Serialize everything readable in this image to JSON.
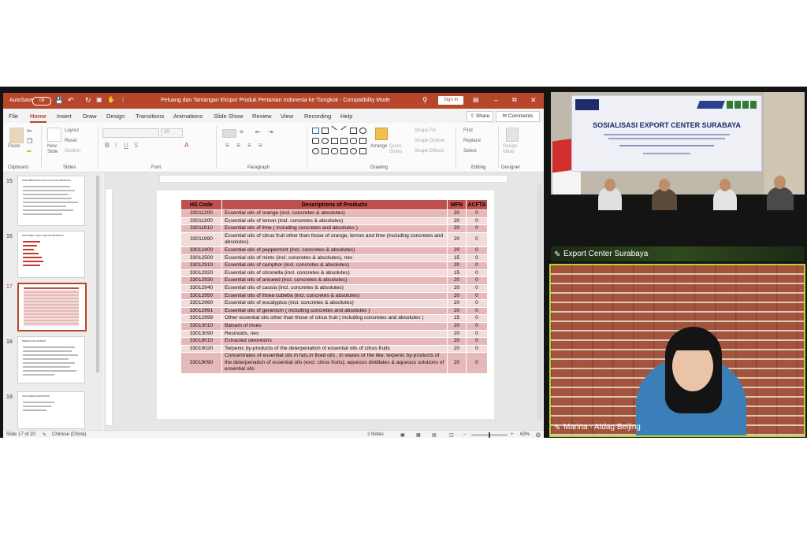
{
  "window": {
    "autosave_label": "AutoSave",
    "autosave_state": "Off",
    "title": "Peluang dan Tantangan Ekspor Produk Pertanian Indonesia ke Tiongkok  -  Compatibility Mode",
    "signin_label": "Sign in"
  },
  "menu": {
    "tabs": [
      "File",
      "Home",
      "Insert",
      "Draw",
      "Design",
      "Transitions",
      "Animations",
      "Slide Show",
      "Review",
      "View",
      "Recording",
      "Help"
    ],
    "active_tab": "Home",
    "share_label": "Share",
    "comments_label": "Comments"
  },
  "ribbon": {
    "paste": "Paste",
    "new_slide": "New Slide",
    "layout": "Layout",
    "reset": "Reset",
    "section": "Section",
    "font_size": "20",
    "arrange": "Arrange",
    "quick_styles": "Quick Styles",
    "shape_fill": "Shape Fill",
    "shape_outline": "Shape Outline",
    "shape_effects": "Shape Effects",
    "find": "Find",
    "replace": "Replace",
    "select": "Select",
    "design_ideas": "Design Ideas",
    "groups": [
      "Clipboard",
      "Slides",
      "Font",
      "Paragraph",
      "Drawing",
      "Editing",
      "Designer"
    ]
  },
  "thumbnails": [
    {
      "number": "15",
      "title": "PERTIMBANGAN KUALITAS DAN KEMASAN"
    },
    {
      "number": "16",
      "title": "DOKUMEN YANG HARUS DISIAPKAN"
    },
    {
      "number": "17",
      "title": ""
    },
    {
      "number": "18",
      "title": "PERAN DAN SUBSIDI"
    },
    {
      "number": "19",
      "title": "AKSI DENGAN EKSPORT"
    }
  ],
  "slide_table": {
    "headers": [
      "HS Code",
      "Descriptions of Products",
      "MFN",
      "ACFTA"
    ],
    "rows": [
      [
        "33011200",
        "Essential oils of orange (incl. concretes & absolutes)",
        "20",
        "0"
      ],
      [
        "33011300",
        "Essential oils of lemon (incl. concretes & absolutes)",
        "20",
        "0"
      ],
      [
        "33011910",
        "Essential oils of lime ( including concretes and absolutes )",
        "20",
        "0"
      ],
      [
        "33011990",
        "Essential oils of citrus fruit other than those of orange, lemon and lime (including concretes and absolutes)",
        "20",
        "0"
      ],
      [
        "33012400",
        "Essential oils of peppermint (incl. concretes & absolutes)",
        "20",
        "0"
      ],
      [
        "33012500",
        "Essential oils of mints (incl. concretes & absolutes), nes",
        "15",
        "0"
      ],
      [
        "33012910",
        "Essential oils of camphor (incl. concretes & absolutes)",
        "20",
        "0"
      ],
      [
        "33012920",
        "Essential oils of citronella (incl. concretes & absolutes)",
        "15",
        "0"
      ],
      [
        "33012930",
        "Essential oils of aniseed (incl. concretes & absolutes)",
        "20",
        "0"
      ],
      [
        "33012940",
        "Essential oils of cassia (incl. concretes & absolutes)",
        "20",
        "0"
      ],
      [
        "33012950",
        "Essential oils of litsea cubeba (incl. concretes & absolutes)",
        "20",
        "0"
      ],
      [
        "33012960",
        "Essential oils of eucalyptus (incl. concretes & absolutes)",
        "20",
        "0"
      ],
      [
        "33012991",
        "Essential oils of geranium ( including concretes and absolutes )",
        "20",
        "0"
      ],
      [
        "33012999",
        "Other essential oils other than those of citrus fruit ( including concretes and absolutes )",
        "15",
        "0"
      ],
      [
        "33013010",
        "Balsam of irises",
        "20",
        "0"
      ],
      [
        "33013090",
        "Resinoids, nes",
        "20",
        "0"
      ],
      [
        "33019010",
        "Extracted oleoresins",
        "20",
        "0"
      ],
      [
        "33019020",
        "Terpenic by-products of the deterpenation of essential oils of citrus fruits",
        "20",
        "0"
      ],
      [
        "33019090",
        "Concentrates of essential oils in fats,in fixed oils , in waxes or the like; terpenic by-products of the deterpenation of essential oils (excl. citrus fruits);  aqueous distillates & aqueous solutions of essential oils",
        "20",
        "0"
      ]
    ]
  },
  "status": {
    "slide_count": "Slide 17 of 20",
    "language": "Chinese (China)",
    "notes": "Notes",
    "zoom": "63%"
  },
  "video": {
    "tile1_name": "Export Center Surabaya",
    "tile2_name": "Marina - Atdag Beijing",
    "banner_title": "SOSIALISASI EXPORT CENTER SURABAYA"
  },
  "colors": {
    "ppt_accent": "#b7472a",
    "table_header": "#c0504d",
    "table_row_light": "#f2dcdb",
    "table_row_dark": "#e6b9b8",
    "active_speaker_border": "#b8d432"
  }
}
